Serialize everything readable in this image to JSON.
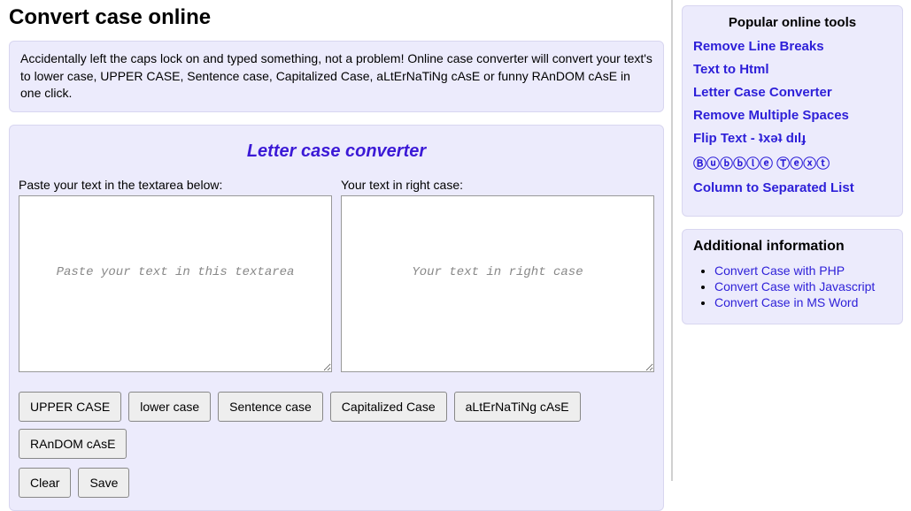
{
  "page": {
    "title": "Convert case online",
    "description": "Accidentally left the caps lock on and typed something, not a problem! Online case converter will convert your text's to lower case, UPPER CASE, Sentence case, Capitalized Case, aLtErNaTiNg cAsE or funny RAnDOM cAsE in one click."
  },
  "tool": {
    "title": "Letter case converter",
    "input_label": "Paste your text in the textarea below:",
    "output_label": "Your text in right case:",
    "input_placeholder": "Paste your text in this textarea",
    "output_placeholder": "Your text in right case",
    "buttons": {
      "upper": "UPPER CASE",
      "lower": "lower case",
      "sentence": "Sentence case",
      "capitalized": "Capitalized Case",
      "alternating": "aLtErNaTiNg cAsE",
      "random": "RAnDOM cAsE",
      "clear": "Clear",
      "save": "Save"
    }
  },
  "sidebar": {
    "popular_heading": "Popular online tools",
    "popular_tools": [
      "Remove Line Breaks",
      "Text to Html",
      "Letter Case Converter",
      "Remove Multiple Spaces",
      "Flip Text - ʇxǝʇ dılɟ",
      "Ⓑⓤⓑⓑⓛⓔ Ⓣⓔⓧⓣ",
      "Column to Separated List"
    ],
    "additional_heading": "Additional information",
    "additional_links": [
      "Convert Case with PHP",
      "Convert Case with Javascript",
      "Convert Case in MS Word"
    ]
  }
}
